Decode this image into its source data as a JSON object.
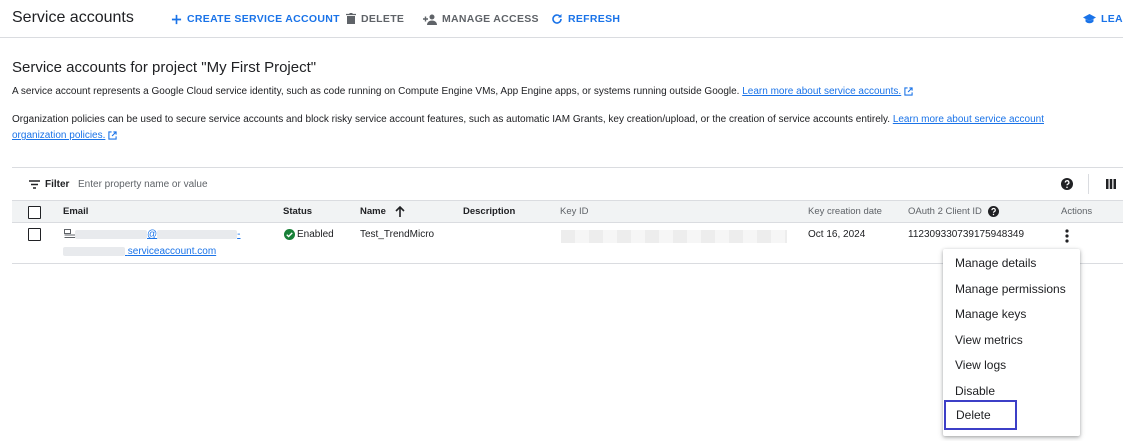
{
  "header": {
    "title": "Service accounts",
    "actions": {
      "create": "CREATE SERVICE ACCOUNT",
      "delete": "DELETE",
      "manage_access": "MANAGE ACCESS",
      "refresh": "REFRESH",
      "learn": "LEAR"
    }
  },
  "main": {
    "heading": "Service accounts for project \"My First Project\"",
    "description1": "A service account represents a Google Cloud service identity, such as code running on Compute Engine VMs, App Engine apps, or systems running outside Google.",
    "description1_link": "Learn more about service accounts.",
    "description2": "Organization policies can be used to secure service accounts and block risky service account features, such as automatic IAM Grants, key creation/upload, or the creation of service accounts entirely.",
    "description2_link_a": "Learn more about service account",
    "description2_link_b": "organization policies."
  },
  "filter": {
    "label": "Filter",
    "placeholder": "Enter property name or value"
  },
  "table": {
    "columns": {
      "email": "Email",
      "status": "Status",
      "name": "Name",
      "description": "Description",
      "key_id": "Key ID",
      "key_creation_date": "Key creation date",
      "oauth_client_id": "OAuth 2 Client ID",
      "actions": "Actions"
    },
    "rows": [
      {
        "email_line1_visible": "@",
        "email_line1_suffix": "-",
        "email_line2_visible": "serviceaccount.com",
        "status": "Enabled",
        "name": "Test_TrendMicro",
        "description": "",
        "key_creation_date": "Oct 16, 2024",
        "oauth_client_id": "112309330739175948349"
      }
    ]
  },
  "context_menu": {
    "items": [
      "Manage details",
      "Manage permissions",
      "Manage keys",
      "View metrics",
      "View logs",
      "Disable",
      "Delete"
    ],
    "highlighted": "Delete"
  },
  "colors": {
    "accent": "#1a73e8",
    "status_ok": "#188038",
    "highlight_border": "#3c3fc7"
  }
}
